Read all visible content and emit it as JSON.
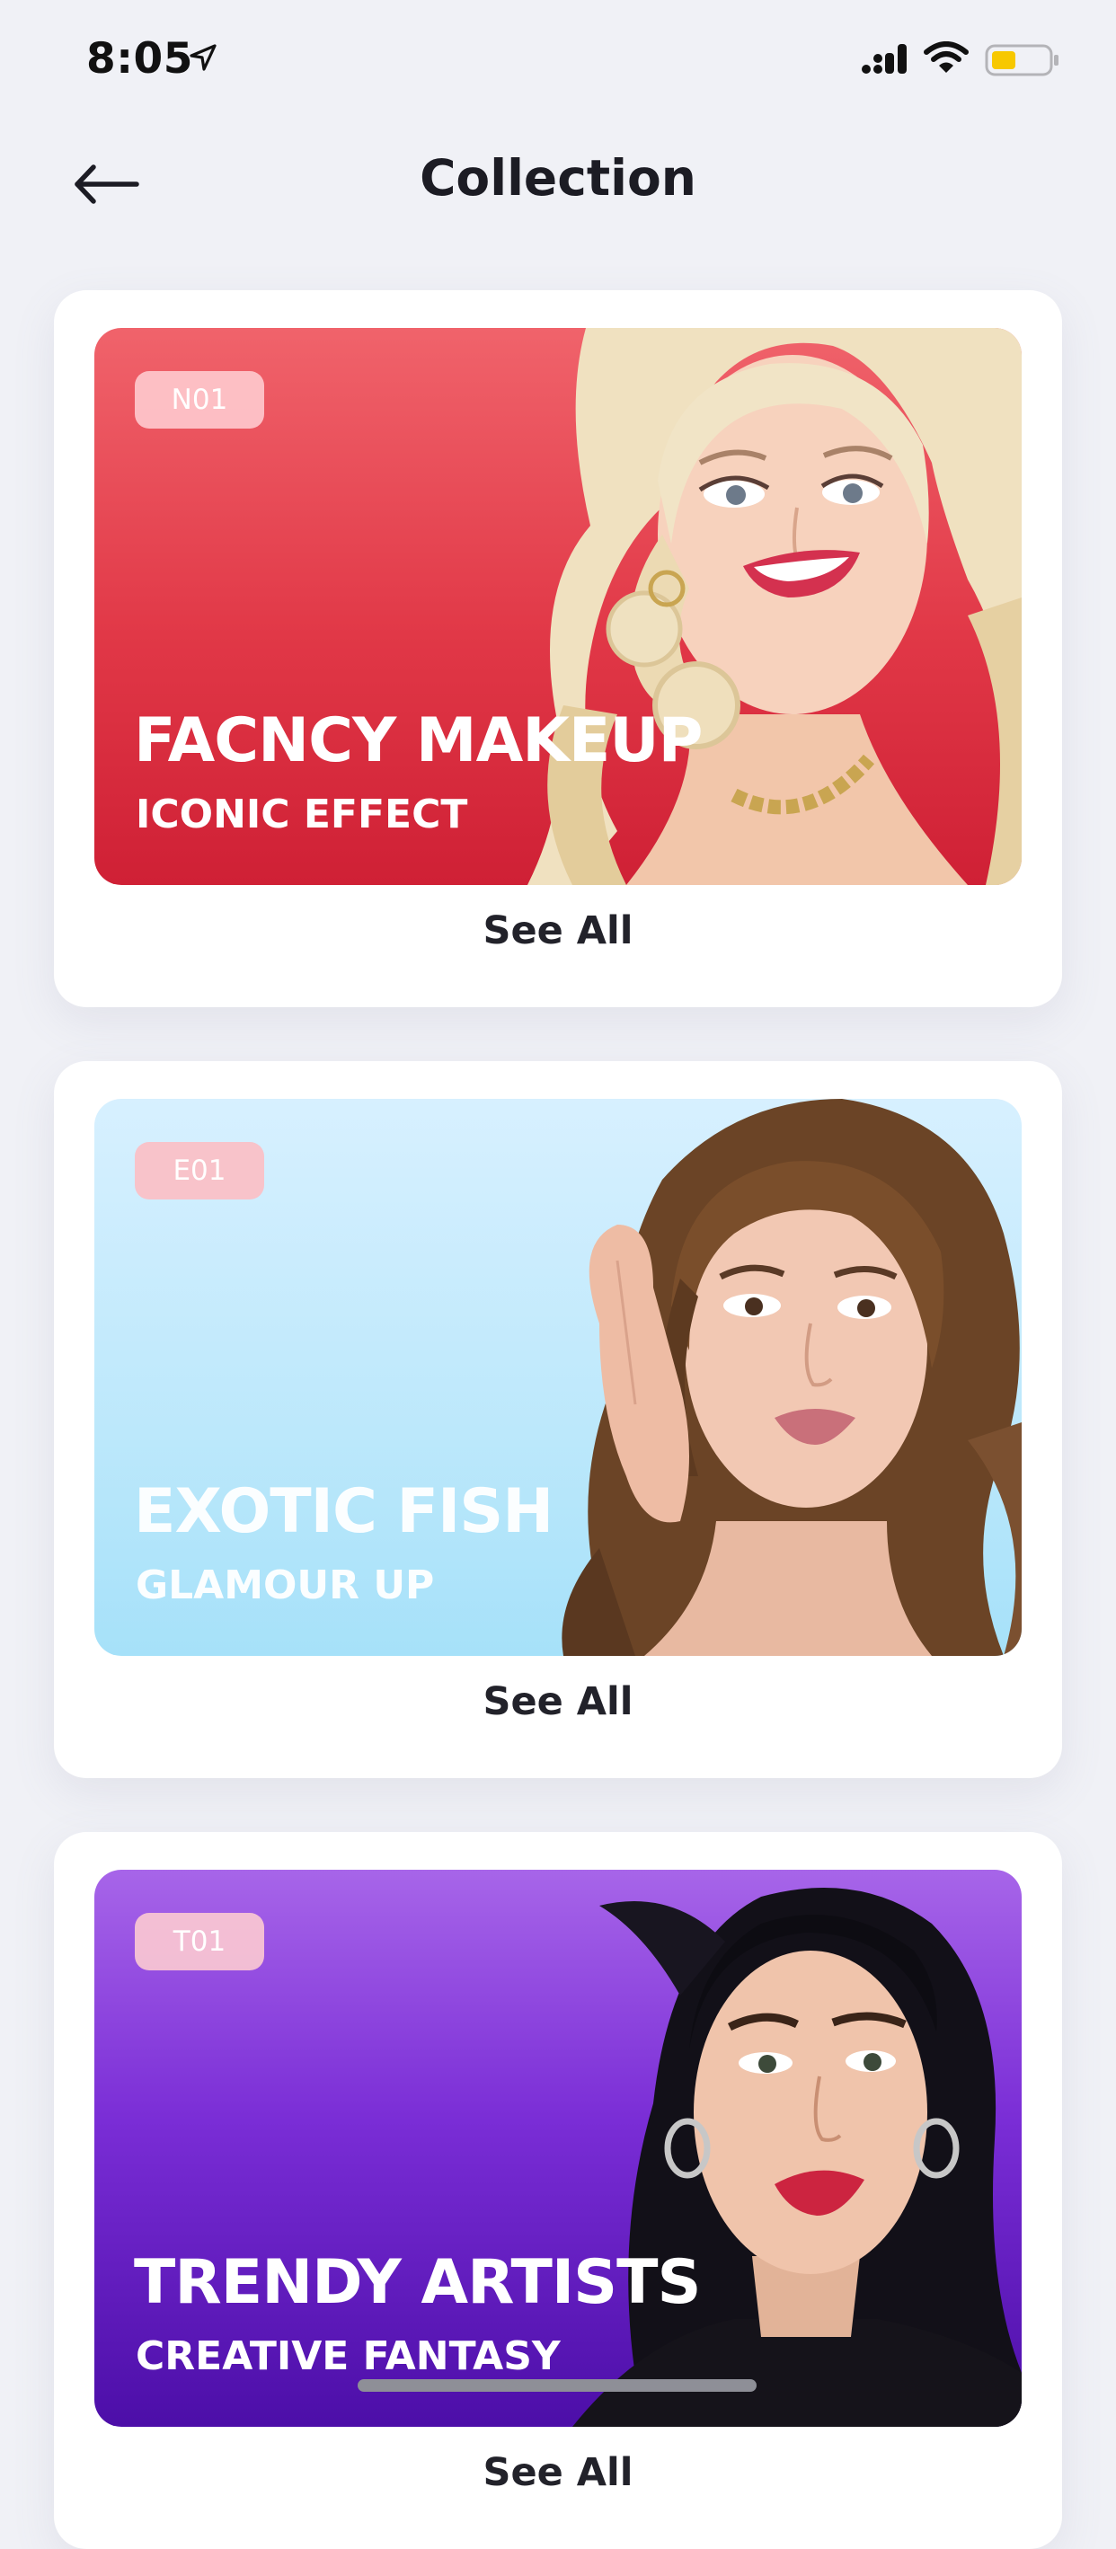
{
  "status_bar": {
    "time": "8:05",
    "icons": [
      "location-arrow-icon",
      "signal-icon",
      "wifi-icon",
      "battery-icon"
    ],
    "battery_color": "#f7c800"
  },
  "header": {
    "back_icon": "arrow-left-icon",
    "title": "Collection"
  },
  "collections": [
    {
      "tag": "N01",
      "title": "FACNCY MAKEUP",
      "subtitle": "ICONIC EFFECT",
      "action": "See All",
      "accent": "#e13847"
    },
    {
      "tag": "E01",
      "title": "EXOTIC FISH",
      "subtitle": "GLAMOUR UP",
      "action": "See All",
      "accent": "#bce8fb"
    },
    {
      "tag": "T01",
      "title": "TRENDY ARTISTS",
      "subtitle": "CREATIVE FANTASY",
      "action": "See All",
      "accent": "#7a2dd6"
    }
  ]
}
